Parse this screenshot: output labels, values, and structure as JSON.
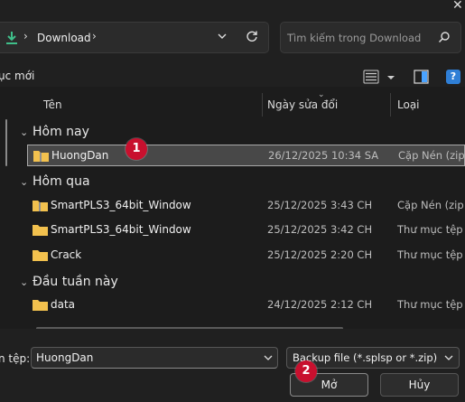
{
  "window": {
    "close_icon": "close-icon"
  },
  "address_bar": {
    "location_icon": "download-arrow-icon",
    "breadcrumb": "Download",
    "separator": "›",
    "dropdown_icon": "chevron-down-icon",
    "refresh_icon": "refresh-icon"
  },
  "search": {
    "placeholder": "Tìm kiếm trong Download",
    "icon": "search-icon"
  },
  "toolbar": {
    "new_folder_label": "ục mới",
    "view_icon": "list-view-icon",
    "pane_icon": "preview-pane-icon",
    "help_label": "?"
  },
  "columns": {
    "name": "Tên",
    "date": "Ngày sửa đổi",
    "type": "Loại"
  },
  "groups": [
    {
      "label": "Hôm nay"
    },
    {
      "label": "Hôm qua"
    },
    {
      "label": "Đầu tuần này"
    }
  ],
  "files": [
    {
      "name": "HuongDan",
      "date": "26/12/2025 10:34 SA",
      "type": "Cặp Nén (zip",
      "icon": "zip-folder-icon",
      "selected": true
    },
    {
      "name": "SmartPLS3_64bit_Window",
      "date": "25/12/2025 3:43 CH",
      "type": "Cặp Nén (zip",
      "icon": "zip-folder-icon"
    },
    {
      "name": "SmartPLS3_64bit_Window",
      "date": "25/12/2025 3:42 CH",
      "type": "Thư mục tệp",
      "icon": "folder-icon"
    },
    {
      "name": "Crack",
      "date": "25/12/2025 2:20 CH",
      "type": "Thư mục tệp",
      "icon": "folder-icon"
    },
    {
      "name": "data",
      "date": "24/12/2025 2:12 CH",
      "type": "Thư mục tệp",
      "icon": "folder-icon"
    }
  ],
  "bottom": {
    "filename_label": "n tệp:",
    "filename_value": "HuongDan",
    "filetype_value": "Backup file (*.splsp or *.zip)",
    "open_label": "Mở",
    "cancel_label": "Hủy"
  },
  "annotations": {
    "badge1": "1",
    "badge2": "2"
  },
  "colors": {
    "accent": "#c8102e",
    "folder": "#f2c14e",
    "background": "#202020"
  }
}
